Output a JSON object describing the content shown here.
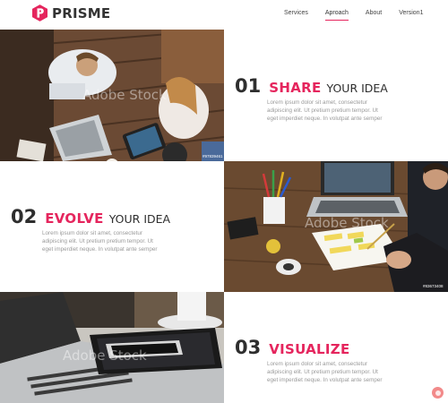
{
  "brand": {
    "name": "PRISME",
    "accent": "#e5255d"
  },
  "nav": [
    {
      "label": "Services",
      "active": false
    },
    {
      "label": "Aproach",
      "active": true
    },
    {
      "label": "About",
      "active": false
    },
    {
      "label": "Version1",
      "active": false
    }
  ],
  "sections": [
    {
      "number": "01",
      "keyword": "SHARE",
      "rest": "YOUR IDEA",
      "lines": [
        "Lorem ipsum dolor sit amet, consectetur",
        "adipiscing elit. Ut pretium pretium tempor. Ut",
        "eget imperdiet neque. In volutpat ante semper"
      ]
    },
    {
      "number": "02",
      "keyword": "EVOLVE",
      "rest": "YOUR IDEA",
      "lines": [
        "Lorem ipsum dolor sit amet, consectetur",
        "adipiscing elit. Ut pretium pretium tempor. Ut",
        "eget imperdiet neque. In volutpat ante semper"
      ]
    },
    {
      "number": "03",
      "keyword": "VISUALIZE",
      "rest": "",
      "lines": [
        "Lorem ipsum dolor sit amet, consectetur",
        "adipiscing elit. Ut pretium pretium tempor. Ut",
        "eget imperdiet neque. In volutpat ante semper"
      ]
    }
  ],
  "photos": {
    "team": {
      "watermark": "Adobe Stock",
      "code": "#97839461"
    },
    "desk": {
      "watermark": "Adobe Stock",
      "code": "#83673408"
    },
    "laptop": {
      "watermark": "Adobe Stock"
    }
  },
  "fab_icon": "circle-icon"
}
